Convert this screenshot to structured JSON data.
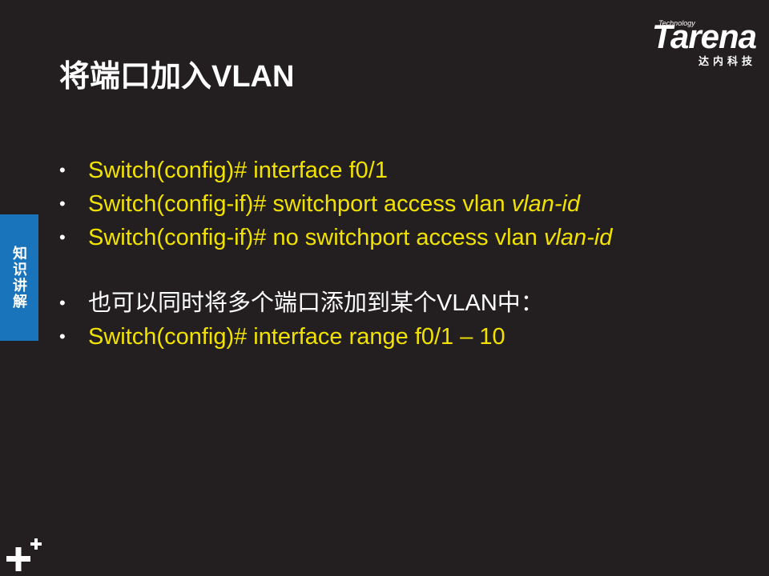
{
  "logo": {
    "tagline": "Technology",
    "brand": "Tarena",
    "chinese": "达内科技"
  },
  "slide": {
    "title": "将端口加入VLAN",
    "side_tab": "知识讲解",
    "bullets": [
      {
        "text": "Switch(config)# interface f0/1",
        "italic": ""
      },
      {
        "text": "Switch(config-if)# switchport access vlan ",
        "italic": "vlan-id"
      },
      {
        "text": "Switch(config-if)# no switchport access vlan ",
        "italic": "vlan-id"
      },
      {
        "text": "也可以同时将多个端口添加到某个VLAN中：",
        "italic": ""
      },
      {
        "text": "Switch(config)# interface range f0/1 – 10",
        "italic": ""
      }
    ]
  },
  "colors": {
    "background": "#231f20",
    "bullet_text": "#f2e200",
    "side_tab": "#1a74bc"
  }
}
